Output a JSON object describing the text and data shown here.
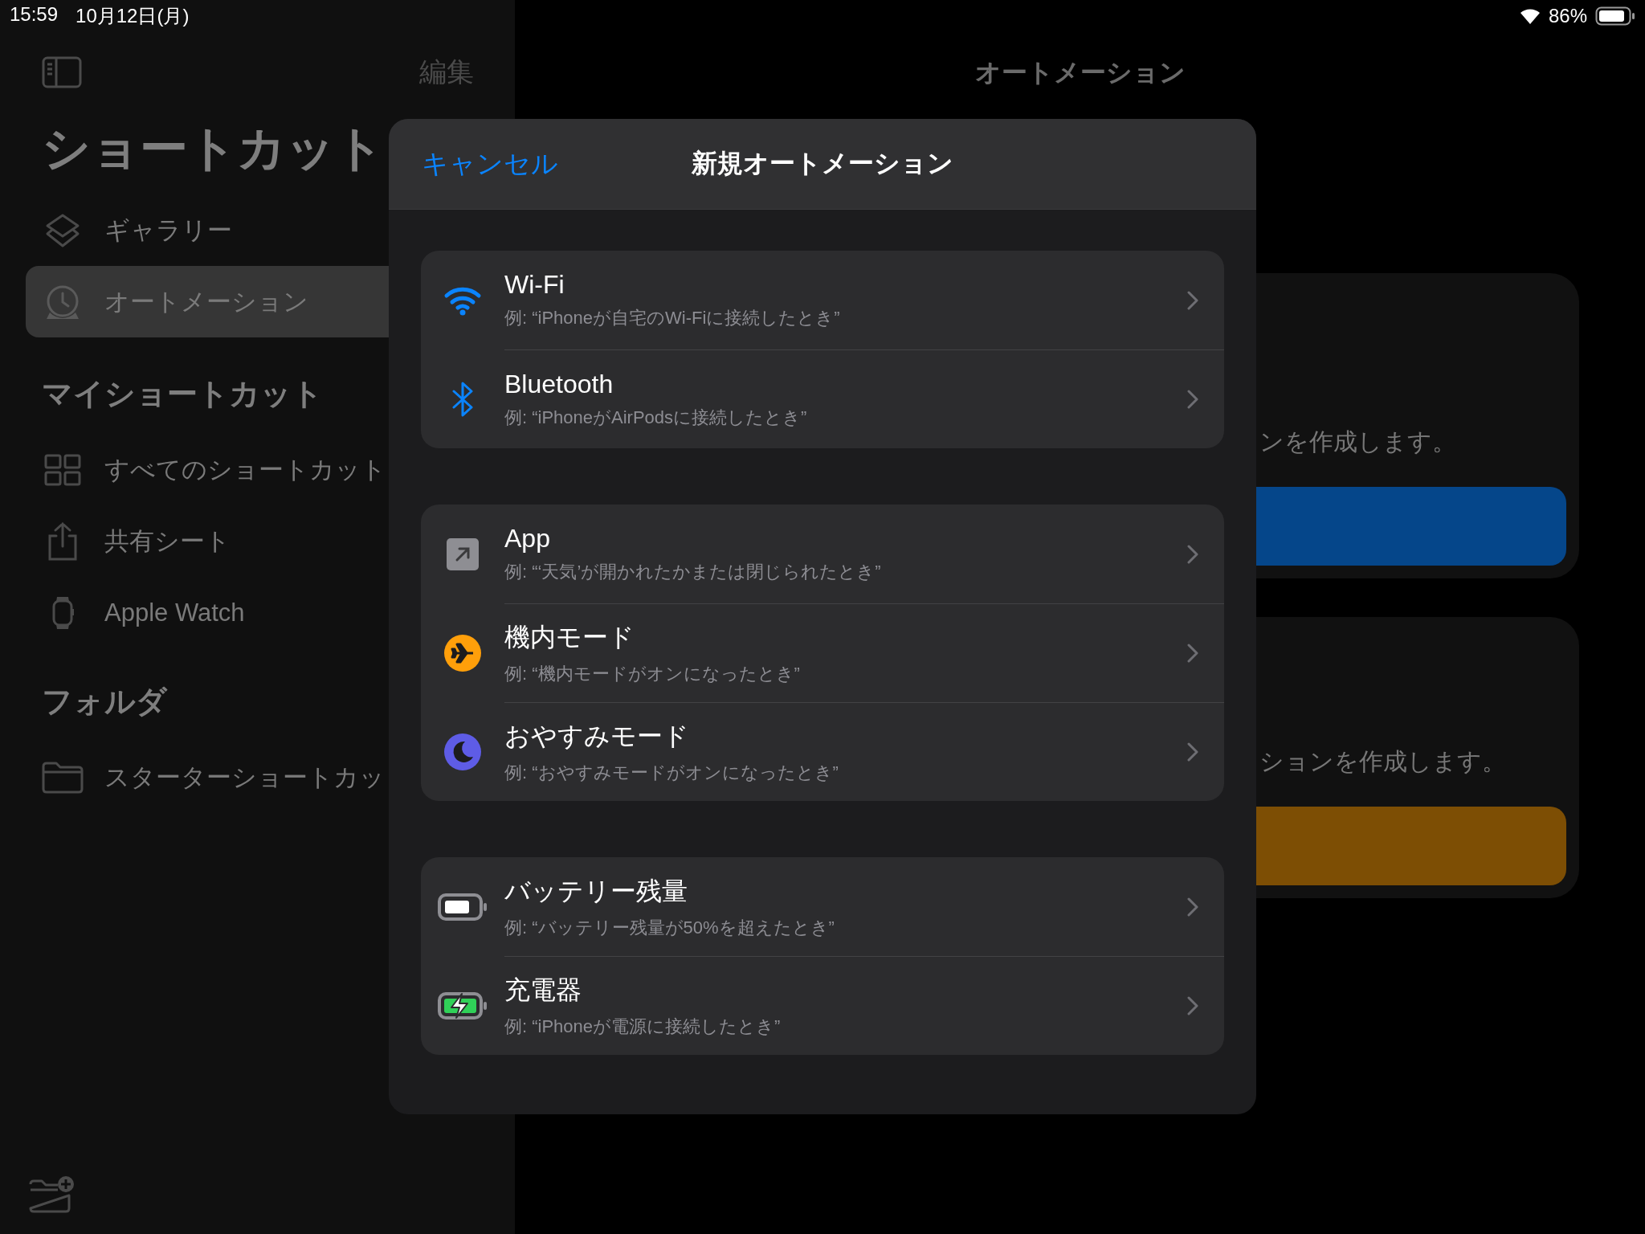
{
  "status_bar": {
    "time": "15:59",
    "date": "10月12日(月)",
    "battery_percent": "86%"
  },
  "sidebar": {
    "edit_button": "編集",
    "title": "ショートカット",
    "items": [
      {
        "label": "ギャラリー",
        "selected": false
      },
      {
        "label": "オートメーション",
        "selected": true
      }
    ],
    "sections": [
      {
        "title": "マイショートカット",
        "items": [
          {
            "label": "すべてのショートカット",
            "selected": false
          },
          {
            "label": "共有シート",
            "selected": false
          },
          {
            "label": "Apple Watch",
            "selected": false
          }
        ]
      },
      {
        "title": "フォルダ",
        "items": [
          {
            "label": "スターターショートカッ",
            "selected": false
          }
        ]
      }
    ]
  },
  "main": {
    "title": "オートメーション",
    "cards": [
      {
        "text": "ンを作成します。",
        "color": "#05468a"
      },
      {
        "text": "ションを作成します。",
        "color": "#7d4e04"
      }
    ]
  },
  "sheet": {
    "cancel": "キャンセル",
    "title": "新規オートメーション",
    "groups": [
      {
        "rows": [
          {
            "kind": "wifi",
            "title": "Wi-Fi",
            "subtitle": "例: “iPhoneが自宅のWi-Fiに接続したとき”"
          },
          {
            "kind": "bluetooth",
            "title": "Bluetooth",
            "subtitle": "例: “iPhoneがAirPodsに接続したとき”"
          }
        ]
      },
      {
        "rows": [
          {
            "kind": "app",
            "title": "App",
            "subtitle": "例: “‘天気’が開かれたかまたは閉じられたとき”"
          },
          {
            "kind": "airplane",
            "title": "機内モード",
            "subtitle": "例: “機内モードがオンになったとき”"
          },
          {
            "kind": "moon",
            "title": "おやすみモード",
            "subtitle": "例: “おやすみモードがオンになったとき”"
          }
        ]
      },
      {
        "rows": [
          {
            "kind": "battery",
            "title": "バッテリー残量",
            "subtitle": "例: “バッテリー残量が50%を超えたとき”"
          },
          {
            "kind": "charger",
            "title": "充電器",
            "subtitle": "例: “iPhoneが電源に接続したとき”"
          }
        ]
      }
    ]
  }
}
